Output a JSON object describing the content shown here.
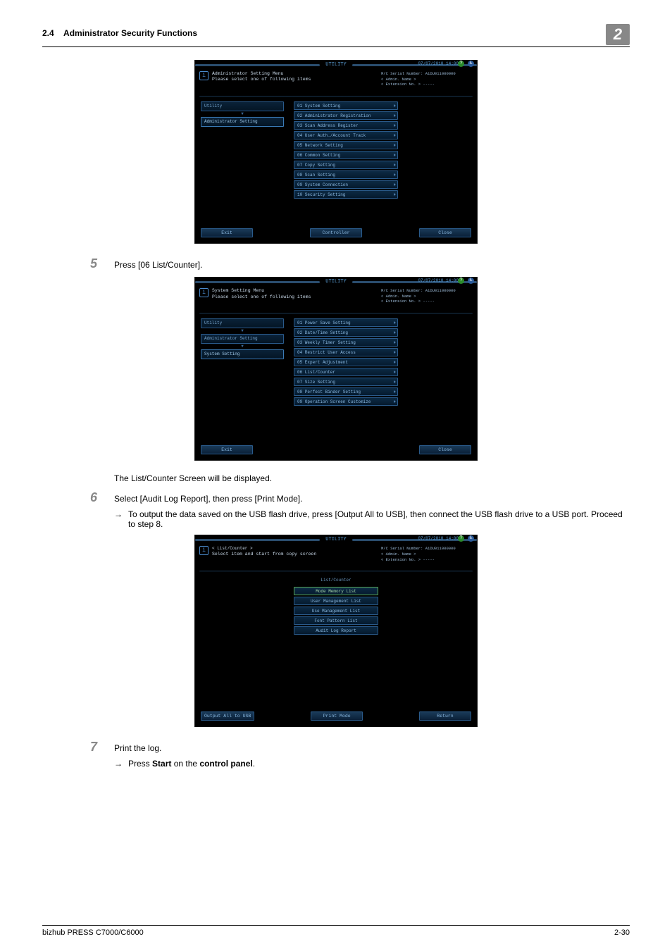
{
  "header": {
    "section": "2.4",
    "title": "Administrator Security Functions",
    "chapter": "2"
  },
  "panel_common": {
    "utility": "UTILITY",
    "datetime": "07/07/2010 14:00",
    "serial_label": "M/C Serial Number:",
    "serial": "A1DU011000000",
    "admin_name": "< Admin. Name >",
    "ext_label": "< Extension No. >",
    "ext_value": "-----"
  },
  "screens": [
    {
      "title1": "Administrator Setting Menu",
      "title2": "Please select one of following items",
      "crumb_items": [
        {
          "label": "Utility",
          "active": false
        },
        {
          "label": "Administrator Setting",
          "active": true
        }
      ],
      "menu": [
        "01 System Setting",
        "02 Administrator Registration",
        "03 Scan Address Register",
        "04 User Auth./Account Track",
        "05 Network Setting",
        "06 Common Setting",
        "07 Copy Setting",
        "08 Scan Setting",
        "09 System Connection",
        "10 Security Setting"
      ],
      "foot_left": "Exit",
      "foot_center": "Controller",
      "foot_right": "Close"
    },
    {
      "title1": "System Setting Menu",
      "title2": "Please select one of following items",
      "crumb_items": [
        {
          "label": "Utility",
          "active": false
        },
        {
          "label": "Administrator Setting",
          "active": false
        },
        {
          "label": "System Setting",
          "active": true
        }
      ],
      "menu": [
        "01 Power Save Setting",
        "02 Date/Time Setting",
        "03 Weekly Timer Setting",
        "04 Restrict User Access",
        "05 Expert Adjustment",
        "06 List/Counter",
        "07 Size Setting",
        "08 Perfect Binder Setting",
        "09 Operation Screen Customize"
      ],
      "foot_left": "Exit",
      "foot_center": "",
      "foot_right": "Close"
    },
    {
      "title1": "< List/Counter >",
      "title2": "Select item and start from copy screen",
      "tab": "List/Counter",
      "menu": [
        "Mode Memory List",
        "User Management List",
        "Use Management List",
        "Font Pattern List",
        "Audit Log Report"
      ],
      "foot_left": "Output All to USB",
      "foot_center": "Print Mode",
      "foot_right": "Return"
    }
  ],
  "steps": {
    "s5": {
      "num": "5",
      "text": "Press [06 List/Counter]."
    },
    "p_after5": "The List/Counter Screen will be displayed.",
    "s6": {
      "num": "6",
      "text": "Select [Audit Log Report], then press [Print Mode]."
    },
    "s6_sub": "To output the data saved on the USB flash drive, press [Output All to USB], then connect the USB flash drive to a USB port. Proceed to step 8.",
    "s7": {
      "num": "7",
      "text": "Print the log."
    },
    "s7_sub_pre": "Press ",
    "s7_sub_b1": "Start",
    "s7_sub_mid": " on the ",
    "s7_sub_b2": "control panel",
    "s7_sub_post": "."
  },
  "footer": {
    "left": "bizhub PRESS C7000/C6000",
    "right": "2-30"
  }
}
